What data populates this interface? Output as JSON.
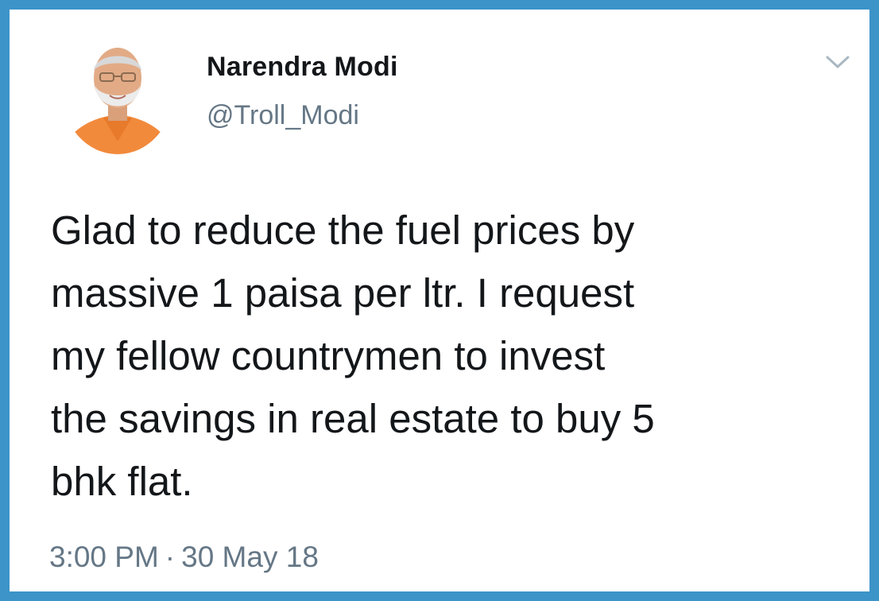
{
  "tweet": {
    "author": {
      "display_name": "Narendra Modi",
      "handle": "@Troll_Modi",
      "avatar_icon": "profile-photo"
    },
    "menu_icon": "chevron-down-icon",
    "text": "Glad to reduce the fuel prices by\nmassive 1 paisa per ltr. I request\nmy fellow countrymen to invest\nthe savings in real estate to buy 5\nbhk flat.",
    "time": "3:00 PM",
    "separator": "·",
    "date": "30 May 18"
  },
  "colors": {
    "frame_border": "#3d94c8",
    "text_primary": "#14171a",
    "text_secondary": "#657786",
    "avatar_garment": "#f28a3c"
  }
}
